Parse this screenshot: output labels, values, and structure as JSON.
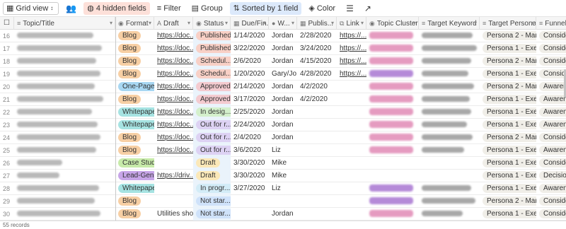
{
  "toolbar": {
    "view_label": "Grid view",
    "hidden_label": "4 hidden fields",
    "filter_label": "Filter",
    "group_label": "Group",
    "sorted_label": "Sorted by 1 field",
    "color_label": "Color"
  },
  "columns": [
    {
      "label": "Topic/Title",
      "icon": "≡"
    },
    {
      "label": "Format",
      "icon": "◉"
    },
    {
      "label": "Draft",
      "icon": "A"
    },
    {
      "label": "Status",
      "icon": "◉"
    },
    {
      "label": "Due/Fin...",
      "icon": "▦"
    },
    {
      "label": "W...",
      "icon": "●"
    },
    {
      "label": "Publis...",
      "icon": "▦"
    },
    {
      "label": "Link",
      "icon": "⧉"
    },
    {
      "label": "Topic Cluster",
      "icon": "◉"
    },
    {
      "label": "Target Keyword",
      "icon": "≡"
    },
    {
      "label": "Target Persona",
      "icon": "≡"
    },
    {
      "label": "Funnel S",
      "icon": "≡"
    }
  ],
  "colors": {
    "blog": "#f7cfa4",
    "one_pager": "#a8d7f2",
    "whitepaper": "#a6e3e2",
    "case_study": "#c7eaa9",
    "lead_gen": "#c7a5e8",
    "published": "#f8d0c6",
    "scheduled": "#f8d0c6",
    "approved": "#f4cbd0",
    "in_design": "#d4f0cc",
    "out_for_review": "#ddd2f3",
    "draft": "#fbe8b8",
    "in_progress": "#d3ecf7",
    "not_started": "#cfe2fa"
  },
  "rows": [
    {
      "num": "16",
      "format": "Blog",
      "format_key": "blog",
      "draft": "https://doc...",
      "status": "Published",
      "status_key": "published",
      "due": "1/14/2020",
      "writer": "Jordan",
      "pub": "2/28/2020",
      "link": "https://...",
      "cluster": "pink",
      "persona": "Persona 2 - Manager",
      "funnel": "Considerati"
    },
    {
      "num": "17",
      "format": "Blog",
      "format_key": "blog",
      "draft": "https://doc...",
      "status": "Published",
      "status_key": "published",
      "due": "3/22/2020",
      "writer": "Jordan",
      "pub": "3/24/2020",
      "link": "https://...",
      "cluster": "pink",
      "persona": "Persona 1 - Executive",
      "funnel": "Considerati"
    },
    {
      "num": "18",
      "format": "Blog",
      "format_key": "blog",
      "draft": "https://doc...",
      "status": "Schedul...",
      "status_key": "scheduled",
      "due": "2/6/2020",
      "writer": "Jordan",
      "pub": "4/15/2020",
      "link": "https://...",
      "cluster": "pink",
      "persona": "Persona 2 - Manager",
      "funnel": "Considerati"
    },
    {
      "num": "19",
      "format": "Blog",
      "format_key": "blog",
      "draft": "https://doc...",
      "status": "Schedul...",
      "status_key": "scheduled",
      "due": "1/20/2020",
      "writer": "Gary/Jo...",
      "pub": "4/28/2020",
      "link": "https://...",
      "cluster": "purple",
      "persona": "Persona 1 - Executive",
      "funnel": "Considerati"
    },
    {
      "num": "20",
      "format": "One-Pager",
      "format_key": "one_pager",
      "draft": "https://doc...",
      "status": "Approved",
      "status_key": "approved",
      "due": "2/14/2020",
      "writer": "Jordan",
      "pub": "4/2/2020",
      "link": "",
      "cluster": "pink",
      "persona": "Persona 2 - Manager",
      "funnel": "Awareness"
    },
    {
      "num": "21",
      "format": "Blog",
      "format_key": "blog",
      "draft": "https://doc...",
      "status": "Approved",
      "status_key": "approved",
      "due": "3/17/2020",
      "writer": "Jordan",
      "pub": "4/2/2020",
      "link": "",
      "cluster": "pink",
      "persona": "Persona 1 - Executive",
      "funnel": "Awareness"
    },
    {
      "num": "22",
      "format": "Whitepaper",
      "format_key": "whitepaper",
      "draft": "https://doc...",
      "status": "In desig...",
      "status_key": "in_design",
      "due": "2/25/2020",
      "writer": "Jordan",
      "pub": "",
      "link": "",
      "cluster": "pink",
      "persona": "Persona 1 - Executive",
      "funnel": "Awareness"
    },
    {
      "num": "23",
      "format": "Whitepaper",
      "format_key": "whitepaper",
      "draft": "https://doc...",
      "status": "Out for r...",
      "status_key": "out_for_review",
      "due": "2/24/2020",
      "writer": "Jordan",
      "pub": "",
      "link": "",
      "cluster": "pink",
      "persona": "Persona 1 - Executive",
      "funnel": "Awareness"
    },
    {
      "num": "24",
      "format": "Blog",
      "format_key": "blog",
      "draft": "https://doc...",
      "status": "Out for r...",
      "status_key": "out_for_review",
      "due": "2/4/2020",
      "writer": "Jordan",
      "pub": "",
      "link": "",
      "cluster": "pink",
      "persona": "Persona 2 - Manager",
      "funnel": "Considerati"
    },
    {
      "num": "25",
      "format": "Blog",
      "format_key": "blog",
      "draft": "https://doc...",
      "status": "Out for r...",
      "status_key": "out_for_review",
      "due": "3/6/2020",
      "writer": "Liz",
      "pub": "",
      "link": "",
      "cluster": "pink",
      "persona": "Persona 1 - Executive",
      "funnel": "Awareness"
    },
    {
      "num": "26",
      "format": "Case Study",
      "format_key": "case_study",
      "draft": "",
      "status": "Draft",
      "status_key": "draft",
      "due": "3/30/2020",
      "writer": "Mike",
      "pub": "",
      "link": "",
      "cluster": "",
      "persona": "Persona 1 - Executive",
      "funnel": "Considerati"
    },
    {
      "num": "27",
      "format": "Lead-Gen",
      "format_key": "lead_gen",
      "draft": "https://driv...",
      "status": "Draft",
      "status_key": "draft",
      "due": "3/30/2020",
      "writer": "Mike",
      "pub": "",
      "link": "",
      "cluster": "",
      "persona": "Persona 1 - Executive",
      "funnel": "Decision -"
    },
    {
      "num": "28",
      "format": "Whitepaper",
      "format_key": "whitepaper",
      "draft": "",
      "status": "In progr...",
      "status_key": "in_progress",
      "due": "3/27/2020",
      "writer": "Liz",
      "pub": "",
      "link": "",
      "cluster": "purple",
      "persona": "Persona 1 - Executive",
      "funnel": "Awareness"
    },
    {
      "num": "29",
      "format": "Blog",
      "format_key": "blog",
      "draft": "",
      "status": "Not star...",
      "status_key": "not_started",
      "due": "",
      "writer": "",
      "pub": "",
      "link": "",
      "cluster": "purple",
      "persona": "Persona 2 - Manager",
      "funnel": "Considerati"
    },
    {
      "num": "30",
      "format": "Blog",
      "format_key": "blog",
      "draft": "Utilities sho...",
      "status": "Not star...",
      "status_key": "not_started",
      "due": "",
      "writer": "Jordan",
      "pub": "",
      "link": "",
      "cluster": "pink",
      "persona": "Persona 1 - Executive",
      "funnel": "Considerati"
    }
  ],
  "footer": {
    "records": "55 records"
  }
}
